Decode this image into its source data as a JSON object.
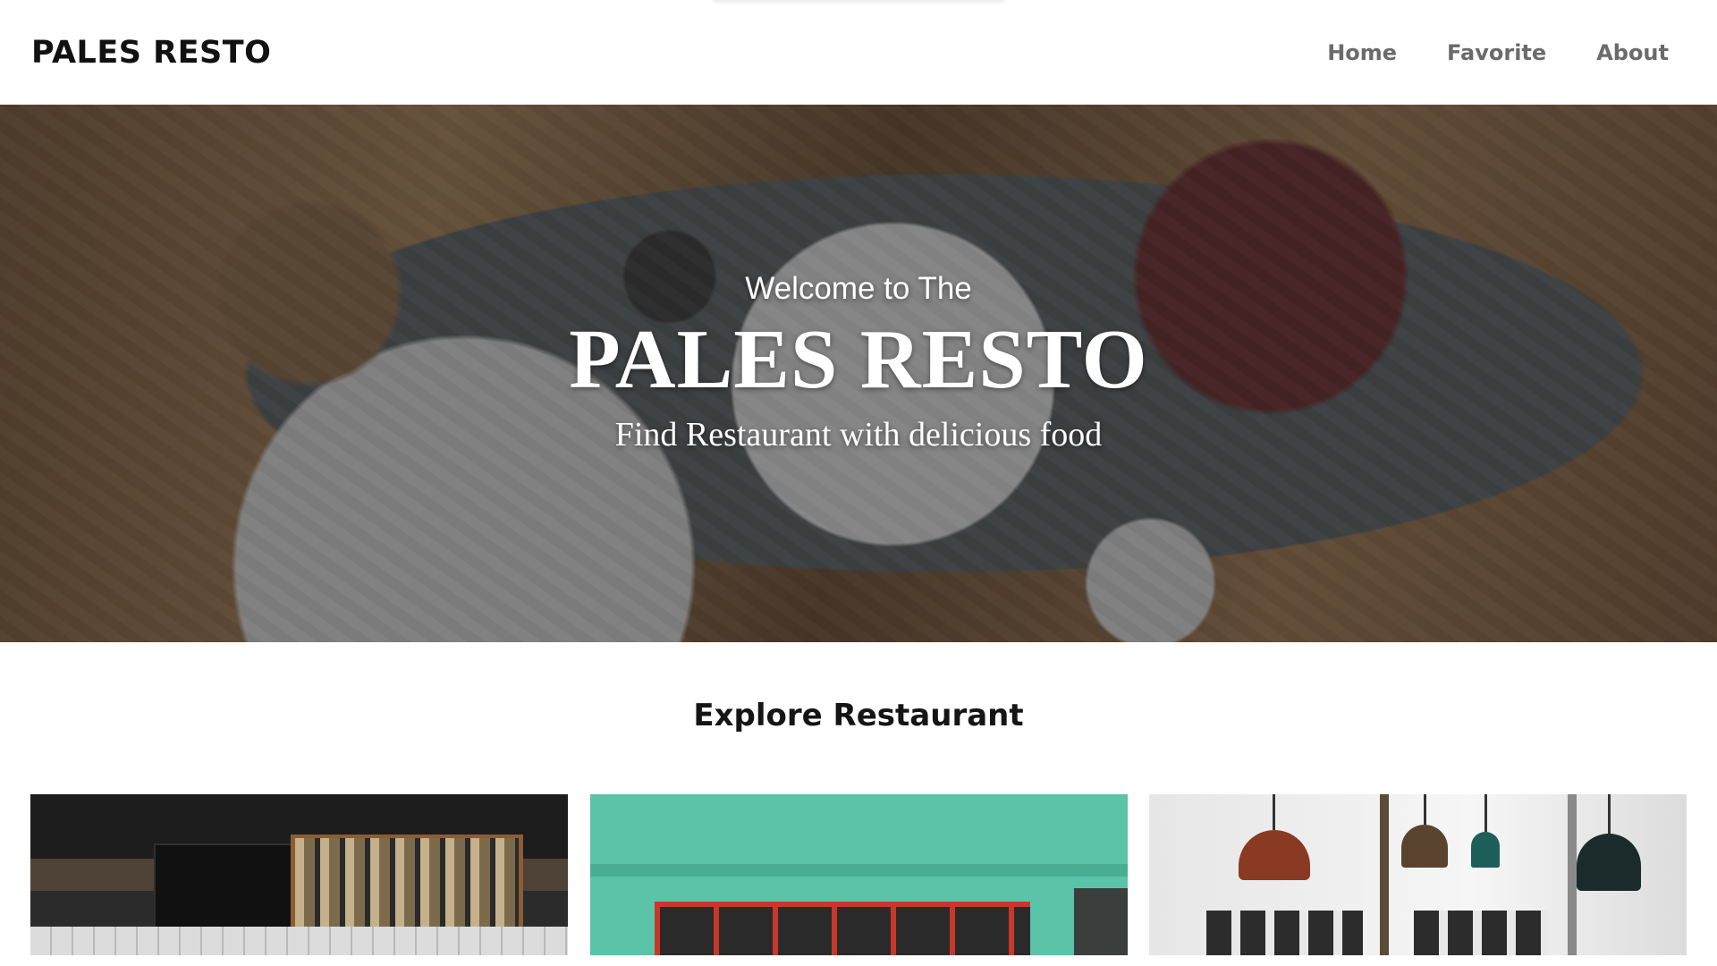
{
  "header": {
    "brand": "PALES RESTO",
    "nav": [
      {
        "label": "Home"
      },
      {
        "label": "Favorite"
      },
      {
        "label": "About"
      }
    ]
  },
  "hero": {
    "welcome": "Welcome to The",
    "title": "PALES RESTO",
    "subtitle": "Find Restaurant with delicious food"
  },
  "explore": {
    "title": "Explore Restaurant",
    "cards": [
      {
        "image": "cafe-bar-photo"
      },
      {
        "image": "green-storefront-photo"
      },
      {
        "image": "pendant-lamps-interior-photo"
      }
    ]
  }
}
